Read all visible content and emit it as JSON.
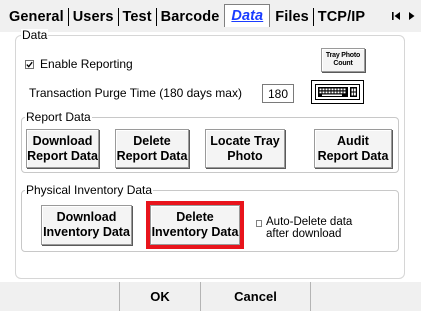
{
  "tabs": [
    {
      "label": "General",
      "active": false
    },
    {
      "label": "Users",
      "active": false
    },
    {
      "label": "Test",
      "active": false
    },
    {
      "label": "Barcode",
      "active": false
    },
    {
      "label": "Data",
      "active": true
    },
    {
      "label": "Files",
      "active": false
    },
    {
      "label": "TCP/IP",
      "active": false
    }
  ],
  "data_group": {
    "legend": "Data",
    "enable_reporting": {
      "label": "Enable Reporting",
      "checked": true
    },
    "tray_photo_button": {
      "line1": "Tray Photo",
      "line2": "Count"
    },
    "purge": {
      "label": "Transaction Purge Time (180 days max)",
      "value": "180"
    },
    "keyboard_icon": "keyboard-icon"
  },
  "report_group": {
    "legend": "Report Data",
    "buttons": {
      "download": {
        "line1": "Download",
        "line2": "Report Data"
      },
      "delete": {
        "line1": "Delete",
        "line2": "Report Data"
      },
      "locate": {
        "line1": "Locate Tray",
        "line2": "Photo"
      },
      "audit": {
        "line1": "Audit",
        "line2": "Report Data"
      }
    }
  },
  "inventory_group": {
    "legend": "Physical Inventory Data",
    "download": {
      "line1": "Download",
      "line2": "Inventory Data"
    },
    "delete": {
      "line1": "Delete",
      "line2": "Inventory Data"
    },
    "auto_delete": {
      "line1": "Auto-Delete data",
      "line2": "after download",
      "checked": false
    }
  },
  "footer": {
    "ok": "OK",
    "cancel": "Cancel"
  },
  "colors": {
    "active_tab": "#1a3cff",
    "highlight": "#e8141c"
  }
}
